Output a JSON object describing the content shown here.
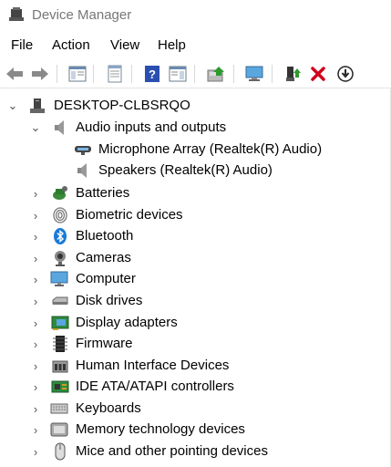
{
  "window": {
    "title": "Device Manager",
    "icon": "computer-management-icon"
  },
  "menu": {
    "items": [
      "File",
      "Action",
      "View",
      "Help"
    ]
  },
  "toolbar": {
    "buttons": [
      {
        "name": "back-button",
        "icon": "arrow-left-icon"
      },
      {
        "name": "forward-button",
        "icon": "arrow-right-icon"
      },
      {
        "name": "show-hide-console-tree-button",
        "icon": "console-tree-icon"
      },
      {
        "name": "properties-button",
        "icon": "properties-sheet-icon"
      },
      {
        "name": "help-button",
        "icon": "help-icon"
      },
      {
        "name": "show-action-pane-button",
        "icon": "action-pane-icon"
      },
      {
        "name": "update-driver-button",
        "icon": "update-driver-icon"
      },
      {
        "name": "scan-hardware-button",
        "icon": "monitor-icon"
      },
      {
        "name": "enable-device-button",
        "icon": "plug-in-icon"
      },
      {
        "name": "uninstall-device-button",
        "icon": "red-x-icon"
      },
      {
        "name": "disable-device-button",
        "icon": "down-arrow-circle-icon"
      }
    ]
  },
  "tree": {
    "root": {
      "label": "DESKTOP-CLBSRQO",
      "icon": "computer-tower-icon",
      "expanded": true
    },
    "nodes": [
      {
        "label": "Audio inputs and outputs",
        "icon": "speaker-icon",
        "expanded": true,
        "children": [
          {
            "label": "Microphone Array (Realtek(R) Audio)",
            "icon": "microphone-icon"
          },
          {
            "label": "Speakers (Realtek(R) Audio)",
            "icon": "speaker-icon"
          }
        ]
      },
      {
        "label": "Batteries",
        "icon": "battery-icon"
      },
      {
        "label": "Biometric devices",
        "icon": "fingerprint-icon"
      },
      {
        "label": "Bluetooth",
        "icon": "bluetooth-icon"
      },
      {
        "label": "Cameras",
        "icon": "webcam-icon"
      },
      {
        "label": "Computer",
        "icon": "monitor-icon"
      },
      {
        "label": "Disk drives",
        "icon": "disk-drive-icon"
      },
      {
        "label": "Display adapters",
        "icon": "display-adapter-icon"
      },
      {
        "label": "Firmware",
        "icon": "chip-icon"
      },
      {
        "label": "Human Interface Devices",
        "icon": "hid-icon"
      },
      {
        "label": "IDE ATA/ATAPI controllers",
        "icon": "ide-controller-icon"
      },
      {
        "label": "Keyboards",
        "icon": "keyboard-icon"
      },
      {
        "label": "Memory technology devices",
        "icon": "memory-card-icon"
      },
      {
        "label": "Mice and other pointing devices",
        "icon": "mouse-icon"
      }
    ]
  },
  "colors": {
    "accent_blue": "#1a7bd6",
    "red_x": "#d0021b",
    "green": "#2e9a2e"
  }
}
